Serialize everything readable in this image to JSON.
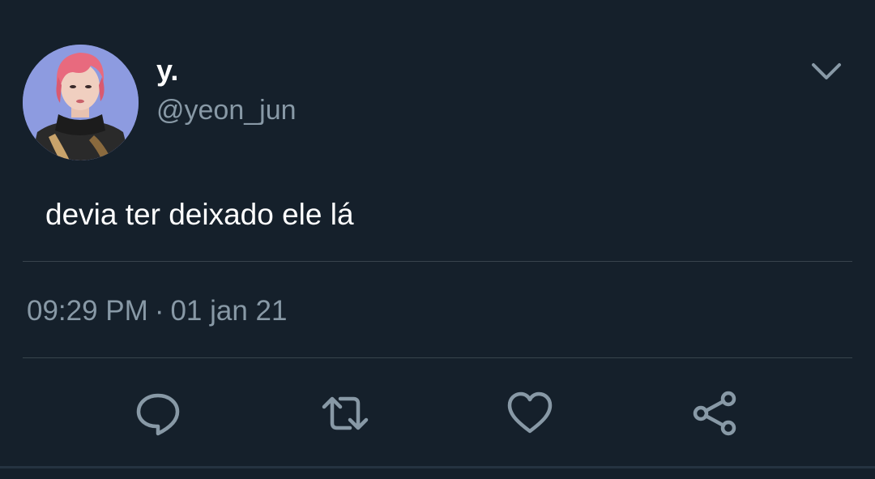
{
  "author": {
    "display_name": "y.",
    "handle": "@yeon_jun",
    "avatar": "profile-photo"
  },
  "tweet": {
    "text": "devia ter deixado ele lá",
    "time": "09:29 PM",
    "separator": "·",
    "date": "01 jan 21"
  },
  "actions": {
    "reply_icon": "reply-icon",
    "retweet_icon": "retweet-icon",
    "like_icon": "heart-icon",
    "share_icon": "share-icon"
  },
  "menu_icon": "chevron-down-icon",
  "colors": {
    "background": "#15202b",
    "primary_text": "#ffffff",
    "secondary_text": "#8899a6",
    "divider": "#38444d"
  }
}
